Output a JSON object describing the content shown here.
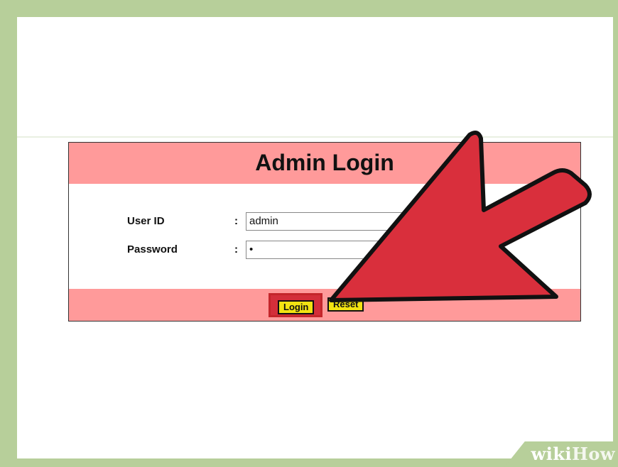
{
  "login_form": {
    "title": "Admin Login",
    "user_id_label": "User ID",
    "user_id_colon": ":",
    "user_id_value": "admin",
    "password_label": "Password",
    "password_colon": ":",
    "password_value": "•",
    "login_label": "Login",
    "reset_label": "Reset"
  },
  "annotation": {
    "arrow_icon": "pointer-arrow-icon",
    "arrow_color": "#d92f3c",
    "highlight_color": "#c4262b"
  },
  "watermark": {
    "brand_wiki": "wiki",
    "brand_how": "How"
  },
  "colors": {
    "frame": "#b7cf9a",
    "band": "#ff9a9a",
    "button": "#f2e312"
  }
}
